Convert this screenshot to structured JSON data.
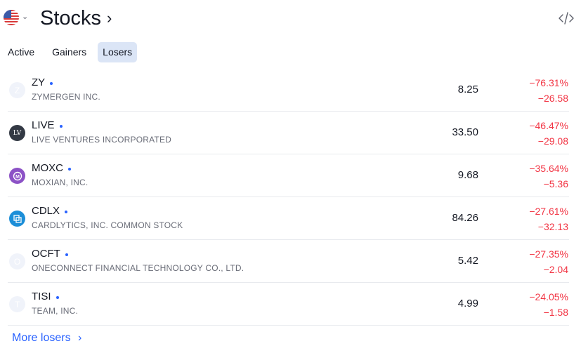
{
  "header": {
    "title": "Stocks",
    "title_chevron": "›",
    "flag_icon": "us-flag-icon",
    "flag_chevron": "⌄",
    "embed_icon": "code-icon"
  },
  "tabs": [
    {
      "label": "Active",
      "active": false
    },
    {
      "label": "Gainers",
      "active": false
    },
    {
      "label": "Losers",
      "active": true
    }
  ],
  "rows": [
    {
      "symbol": "ZY",
      "company": "ZYMERGEN INC.",
      "logo_letter": "Z",
      "price": "8.25",
      "change_pct": "−76.31%",
      "change": "−26.58"
    },
    {
      "symbol": "LIVE",
      "company": "LIVE VENTURES INCORPORATED",
      "logo_letter": "LV",
      "price": "33.50",
      "change_pct": "−46.47%",
      "change": "−29.08"
    },
    {
      "symbol": "MOXC",
      "company": "MOXIAN, INC.",
      "logo_letter": "M",
      "price": "9.68",
      "change_pct": "−35.64%",
      "change": "−5.36"
    },
    {
      "symbol": "CDLX",
      "company": "CARDLYTICS, INC. COMMON STOCK",
      "logo_letter": "",
      "price": "84.26",
      "change_pct": "−27.61%",
      "change": "−32.13"
    },
    {
      "symbol": "OCFT",
      "company": "ONECONNECT FINANCIAL TECHNOLOGY CO., LTD.",
      "logo_letter": "O",
      "price": "5.42",
      "change_pct": "−27.35%",
      "change": "−2.04"
    },
    {
      "symbol": "TISI",
      "company": "TEAM, INC.",
      "logo_letter": "T",
      "price": "4.99",
      "change_pct": "−24.05%",
      "change": "−1.58"
    }
  ],
  "footer": {
    "more_label": "More losers",
    "more_chevron": "›"
  },
  "colors": {
    "negative": "#f23645",
    "link": "#2962ff",
    "active_tab_bg": "#dbe5f6"
  }
}
